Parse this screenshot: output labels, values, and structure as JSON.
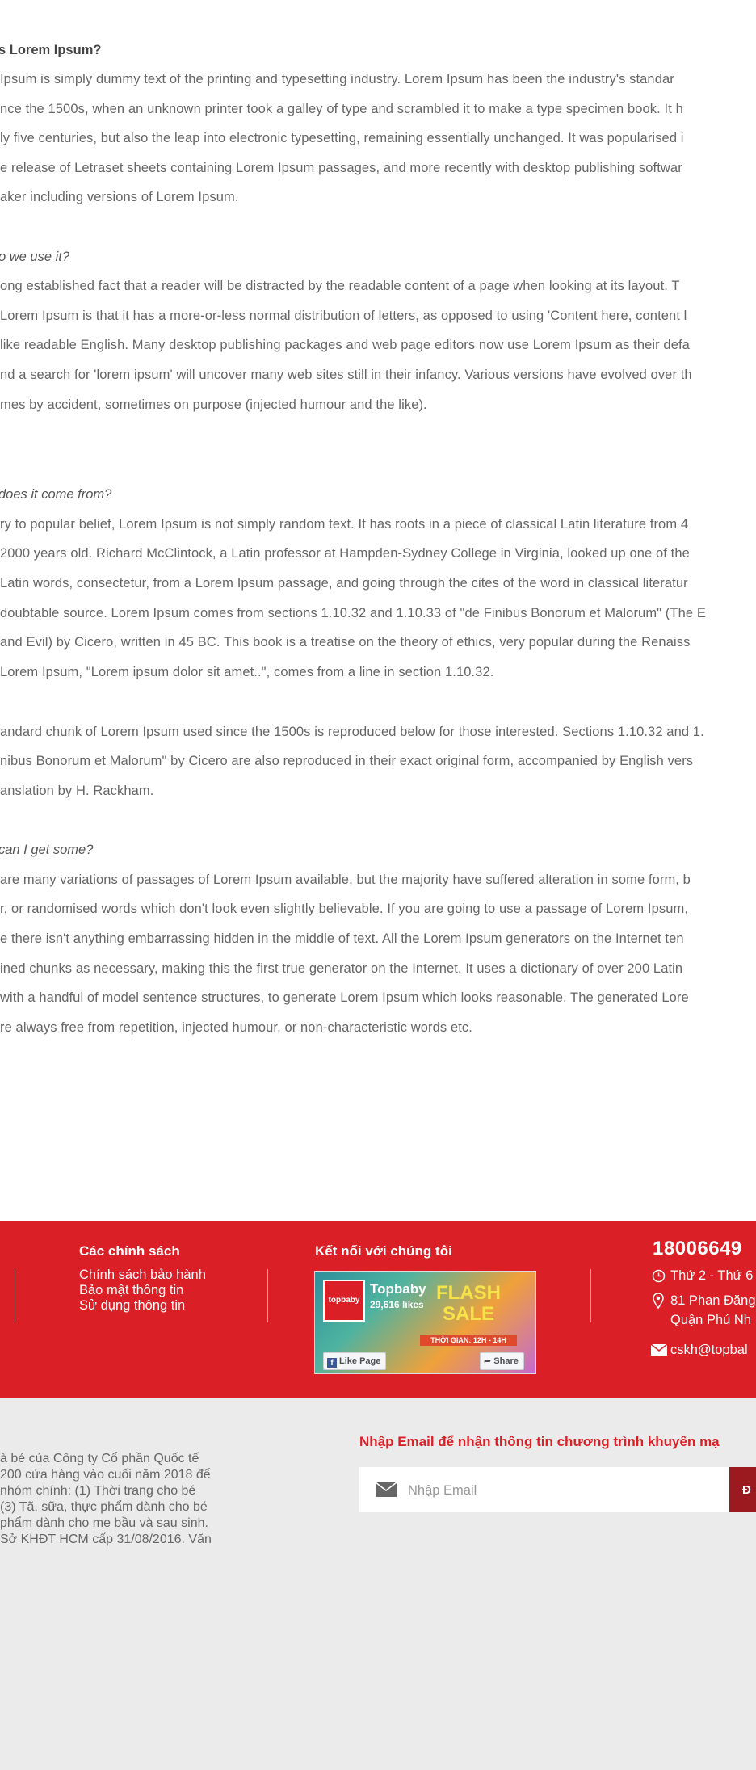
{
  "article": {
    "sections": [
      {
        "heading": "s Lorem Ipsum?",
        "heading_style": "bold",
        "lines": [
          " Ipsum is simply dummy text of the printing and typesetting industry. Lorem Ipsum has been the industry's standar",
          "nce the 1500s, when an unknown printer took a galley of type and scrambled it to make a type specimen book. It h",
          "ly five centuries, but also the leap into electronic typesetting, remaining essentially unchanged. It was popularised i",
          "e release of Letraset sheets containing Lorem Ipsum passages, and more recently with desktop publishing softwar",
          "aker including versions of Lorem Ipsum."
        ]
      },
      {
        "heading": "o we use it?",
        "heading_style": "italic",
        "lines": [
          "ong established fact that a reader will be distracted by the readable content of a page when looking at its layout. T",
          "Lorem Ipsum is that it has a more-or-less normal distribution of letters, as opposed to using 'Content here, content l",
          "like readable English. Many desktop publishing packages and web page editors now use Lorem Ipsum as their defa",
          "nd a search for 'lorem ipsum' will uncover many web sites still in their infancy. Various versions have evolved over th",
          "mes by accident, sometimes on purpose (injected humour and the like)."
        ]
      },
      {
        "heading": " does it come from?",
        "heading_style": "italic",
        "lines": [
          "ry to popular belief, Lorem Ipsum is not simply random text. It has roots in a piece of classical Latin literature from 4",
          "2000 years old. Richard McClintock, a Latin professor at Hampden-Sydney College in Virginia, looked up one of the",
          "Latin words, consectetur, from a Lorem Ipsum passage, and going through the cites of the word in classical literatur",
          "doubtable source. Lorem Ipsum comes from sections 1.10.32 and 1.10.33 of \"de Finibus Bonorum et Malorum\" (The E",
          "and Evil) by Cicero, written in 45 BC. This book is a treatise on the theory of ethics, very popular during the Renaiss",
          "Lorem Ipsum, \"Lorem ipsum dolor sit amet..\", comes from a line in section 1.10.32."
        ]
      },
      {
        "heading": "",
        "heading_style": "none",
        "lines": [
          "andard chunk of Lorem Ipsum used since the 1500s is reproduced below for those interested. Sections 1.10.32 and 1.",
          "nibus Bonorum et Malorum\" by Cicero are also reproduced in their exact original form, accompanied by English vers",
          "anslation by H. Rackham."
        ]
      },
      {
        "heading": " can I get some?",
        "heading_style": "italic",
        "lines": [
          "are many variations of passages of Lorem Ipsum available, but the majority have suffered alteration in some form, b",
          "r, or randomised words which don't look even slightly believable. If you are going to use a passage of Lorem Ipsum,",
          "e there isn't anything embarrassing hidden in the middle of text. All the Lorem Ipsum generators on the Internet ten",
          "ined chunks as necessary, making this the first true generator on the Internet. It uses a dictionary of over 200 Latin",
          "with a handful of model sentence structures, to generate Lorem Ipsum which looks reasonable. The generated Lore",
          "re always free from repetition, injected humour, or non-characteristic words etc."
        ]
      }
    ]
  },
  "footer": {
    "policies": {
      "title": "Các chính sách",
      "links": [
        "Chính sách bảo hành",
        "Bảo mật thông tin",
        "Sử dụng thông tin"
      ]
    },
    "social": {
      "title": "Kết nối với chúng tôi",
      "fb_page_name": "Topbaby",
      "fb_likes": "29,616 likes",
      "fb_logo_text": "topbaby",
      "banner_text": "FLASH SALE",
      "banner_time": "THỜI GIAN: 12H - 14H",
      "like_button": "Like Page",
      "share_button": "Share"
    },
    "contact": {
      "phone": "18006649",
      "hours": "Thứ 2 - Thứ 6",
      "address_line1": "81 Phan Đăng",
      "address_line2": "Quận Phú Nh",
      "email": "cskh@topbal"
    },
    "accent_color": "#da1f26"
  },
  "bottom": {
    "about_lines": [
      "à bé của Công ty Cổ phần Quốc tế",
      " 200 cửa hàng vào cuối năm 2018 để",
      "nhóm chính: (1)    Thời trang cho bé",
      " (3) Tã, sữa, thực phẩm dành cho bé",
      " phẩm dành cho mẹ bầu và sau sinh.",
      " Sở KHĐT HCM cấp 31/08/2016. Văn"
    ],
    "newsletter": {
      "title": "Nhập Email để nhận thông tin chương trình khuyến mạ",
      "placeholder": "Nhập Email",
      "submit_label": "Đ"
    }
  }
}
